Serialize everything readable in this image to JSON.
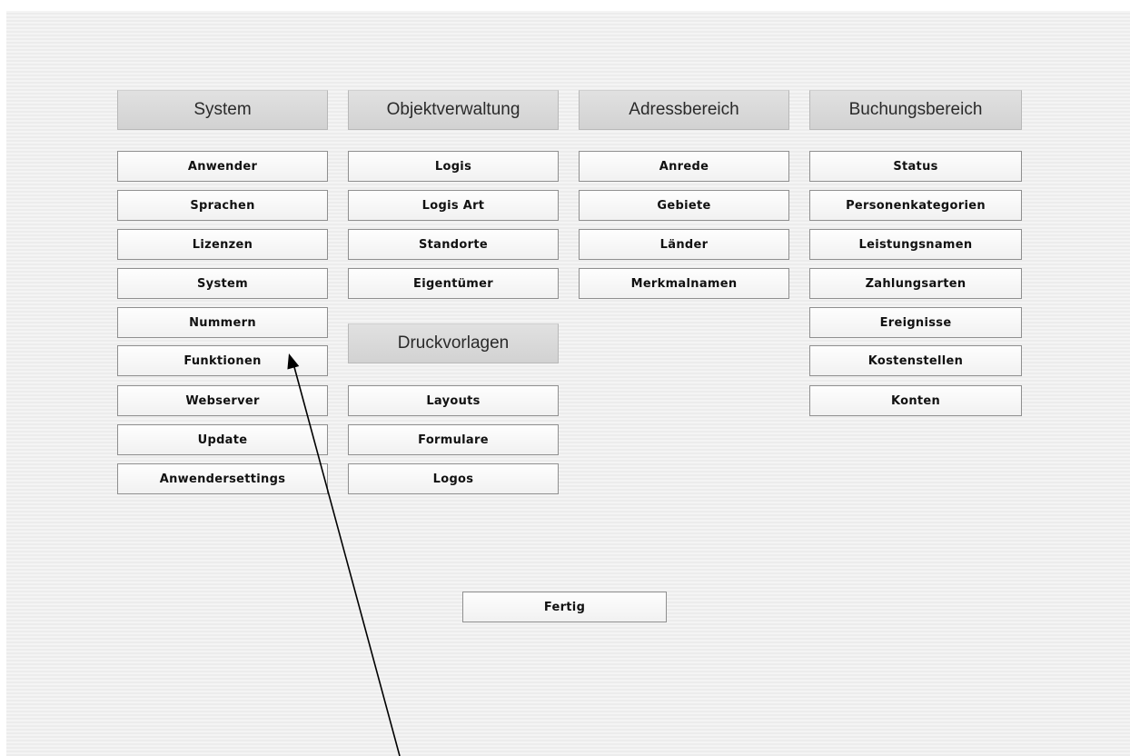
{
  "sections": {
    "system": {
      "title": "System",
      "items": [
        "Anwender",
        "Sprachen",
        "Lizenzen",
        "System",
        "Nummern",
        "Funktionen",
        "Webserver",
        "Update",
        "Anwendersettings"
      ]
    },
    "objektverwaltung": {
      "title": "Objektverwaltung",
      "items": [
        "Logis",
        "Logis Art",
        "Standorte",
        "Eigentümer"
      ]
    },
    "druckvorlagen": {
      "title": "Druckvorlagen",
      "items": [
        "Layouts",
        "Formulare",
        "Logos"
      ]
    },
    "adressbereich": {
      "title": "Adressbereich",
      "items": [
        "Anrede",
        "Gebiete",
        "Länder",
        "Merkmalnamen"
      ]
    },
    "buchungsbereich": {
      "title": "Buchungsbereich",
      "items": [
        "Status",
        "Personenkategorien",
        "Leistungsnamen",
        "Zahlungsarten",
        "Ereignisse",
        "Kostenstellen",
        "Konten"
      ]
    }
  },
  "footer": {
    "done_label": "Fertig"
  },
  "annotation": {
    "icon": "arrow-pointer-icon",
    "color": "#000000"
  }
}
